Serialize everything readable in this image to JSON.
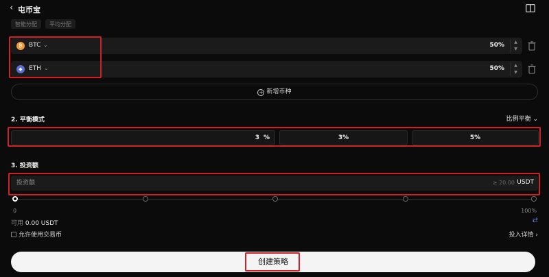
{
  "header": {
    "title": "屯币宝",
    "back_icon": "chevron-left-icon",
    "guide_icon": "book-icon"
  },
  "chips": [
    "智能分配",
    "平均分配"
  ],
  "coins": [
    {
      "symbol": "BTC",
      "percent": "50%",
      "icon_color": "#f09a3a",
      "icon_glyph": "₿"
    },
    {
      "symbol": "ETH",
      "percent": "50%",
      "icon_color": "#5b6fd6",
      "icon_glyph": "◆"
    }
  ],
  "add_coin_label": "新增币种",
  "section2": {
    "label": "2. 平衡模式",
    "mode_select": "比例平衡"
  },
  "balance": {
    "custom_value": "3",
    "custom_unit": "%",
    "preset_1": "3%",
    "preset_2": "5%"
  },
  "section3": {
    "label": "3. 投资额"
  },
  "invest": {
    "placeholder": "投资额",
    "min_hint": "≥ 20.00",
    "unit": "USDT"
  },
  "slider": {
    "value_percent": 0,
    "label_min": "0",
    "label_max": "100%"
  },
  "available": {
    "label": "可用",
    "amount": "0.00 USDT"
  },
  "allow_trading_coin": {
    "label": "允许使用交易币",
    "checked": false
  },
  "detail_link": "投入详情 ›",
  "create_button": "创建策略",
  "colors": {
    "background": "#0b0b0b",
    "field": "#1b1b1b",
    "highlight": "#d32027",
    "accent_link": "#5b7bd5",
    "button": "#f4f4f4"
  }
}
